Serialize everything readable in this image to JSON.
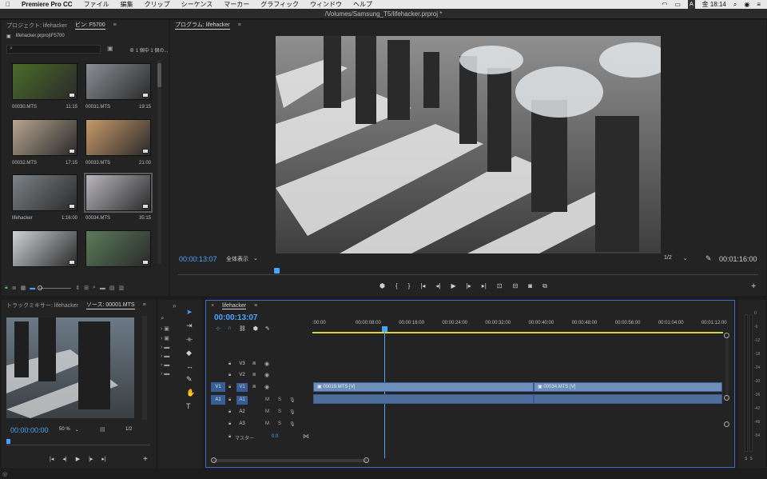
{
  "menubar": {
    "apple": "",
    "app": "Premiere Pro CC",
    "items": [
      "ファイル",
      "編集",
      "クリップ",
      "シーケンス",
      "マーカー",
      "グラフィック",
      "ウィンドウ",
      "ヘルプ"
    ],
    "status_a": "A",
    "clock": "金 18:14"
  },
  "window": {
    "title": "/Volumes/Samsung_T5/lifehacker.prproj *"
  },
  "project": {
    "tab1": "プロジェクト: lifehacker",
    "tab2": "ビン: F5700",
    "path": "lifehacker.prproj\\F5700",
    "items_count": "1 個中 1 個の...",
    "thumbs": [
      {
        "name": "00030.MTS",
        "dur": "11:15",
        "color": "#4b6b2a"
      },
      {
        "name": "00031.MTS",
        "dur": "19:15",
        "color": "#8a8f94"
      },
      {
        "name": "00032.MTS",
        "dur": "17:15",
        "color": "#b7a58f"
      },
      {
        "name": "00033.MTS",
        "dur": "21:00",
        "color": "#c69a6a"
      },
      {
        "name": "lifehacker",
        "dur": "1:16:00",
        "color": "#7c8286"
      },
      {
        "name": "00034.MTS",
        "dur": "35:15",
        "color": "#b9b7bd"
      },
      {
        "name": "",
        "dur": "",
        "color": "#cfd2d6"
      },
      {
        "name": "",
        "dur": "",
        "color": "#5b7c5a"
      }
    ]
  },
  "program": {
    "tab": "プログラム: lifehacker",
    "timecode": "00:00:13:07",
    "fit": "全体表示",
    "quality": "1/2",
    "duration": "00:01:16:00"
  },
  "source": {
    "tab1": "トラックミキサー: lifehacker",
    "tab2": "ソース: 00001.MTS",
    "timecode": "00:00:00:00",
    "zoom": "50 %",
    "quality": "1/2"
  },
  "timeline": {
    "tab": "lifehacker",
    "timecode": "00:00:13:07",
    "ruler": [
      ":00:00",
      "00:00:08:00",
      "00:00:16:00",
      "00:00:24:00",
      "00:00:32:00",
      "00:00:40:00",
      "00:00:48:00",
      "00:00:56:00",
      "00:01:04:00",
      "00:01:12:00"
    ],
    "tracks_video": [
      {
        "target": "",
        "name": "V3"
      },
      {
        "target": "",
        "name": "V2"
      },
      {
        "target": "V1",
        "name": "V1"
      }
    ],
    "tracks_audio": [
      {
        "target": "A1",
        "name": "A1"
      },
      {
        "target": "",
        "name": "A2"
      },
      {
        "target": "",
        "name": "A3"
      }
    ],
    "master_label": "マスター",
    "master_value": "0.0",
    "m_label": "M",
    "s_label": "S",
    "clips": [
      {
        "name": "00019.MTS [V]"
      },
      {
        "name": "00034.MTS [V]"
      }
    ]
  },
  "meters": {
    "ticks": [
      "0",
      "-6",
      "-12",
      "-18",
      "-24",
      "-30",
      "-36",
      "-42",
      "-48",
      "-54"
    ],
    "bottom": [
      "S",
      "S"
    ]
  },
  "colors": {
    "accent": "#4aa3ff",
    "clip": "#6f8fbd",
    "timeline_border": "#3b6bd6"
  }
}
